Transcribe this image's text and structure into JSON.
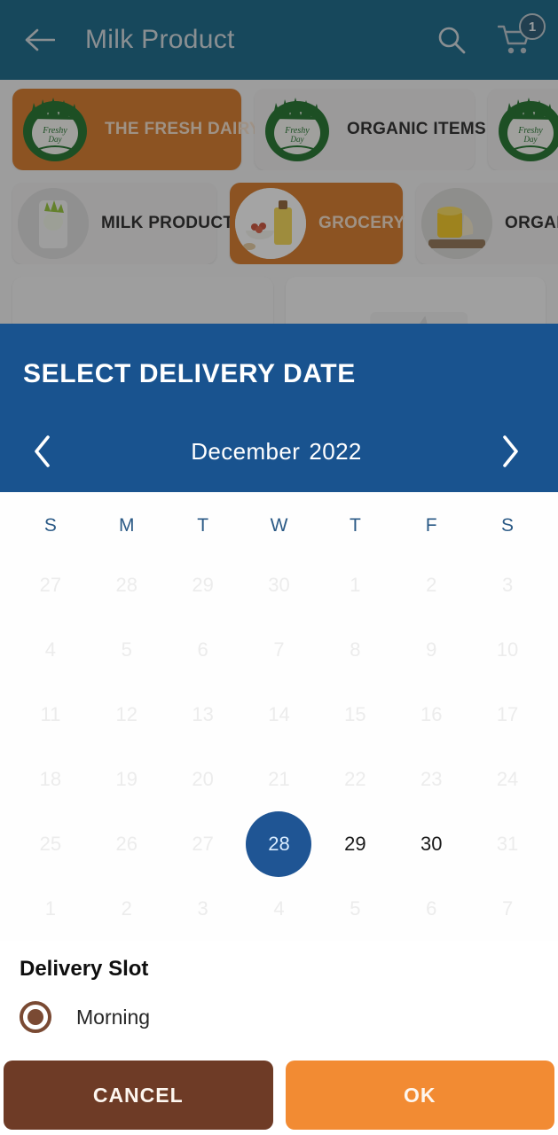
{
  "appbar": {
    "back_icon": "arrow-left-icon",
    "title": "Milk Product",
    "search_icon": "search-icon",
    "cart_icon": "shopping-cart-icon",
    "cart_badge": "1"
  },
  "categories": {
    "row1": [
      {
        "label": "THE FRESH DAIRY",
        "selected": true,
        "media": "logo"
      },
      {
        "label": "ORGANIC ITEMS",
        "selected": false,
        "media": "logo"
      },
      {
        "label": "",
        "selected": false,
        "media": "logo"
      }
    ],
    "row2": [
      {
        "label": "MILK PRODUCT",
        "selected": false,
        "media": "milk-pack-photo"
      },
      {
        "label": "GROCERY",
        "selected": true,
        "media": "grocery-photo"
      },
      {
        "label": "ORGANIC",
        "selected": false,
        "media": "butter-photo"
      }
    ]
  },
  "dialog": {
    "title": "SELECT DELIVERY DATE",
    "prev_icon": "chevron-left-icon",
    "next_icon": "chevron-right-icon",
    "month": "December",
    "year": "2022",
    "weekdays": [
      "S",
      "M",
      "T",
      "W",
      "T",
      "F",
      "S"
    ],
    "weeks": [
      [
        {
          "d": "27",
          "state": "muted"
        },
        {
          "d": "28",
          "state": "muted"
        },
        {
          "d": "29",
          "state": "muted"
        },
        {
          "d": "30",
          "state": "muted"
        },
        {
          "d": "1",
          "state": "muted"
        },
        {
          "d": "2",
          "state": "muted"
        },
        {
          "d": "3",
          "state": "muted"
        }
      ],
      [
        {
          "d": "4",
          "state": "muted"
        },
        {
          "d": "5",
          "state": "muted"
        },
        {
          "d": "6",
          "state": "muted"
        },
        {
          "d": "7",
          "state": "muted"
        },
        {
          "d": "8",
          "state": "muted"
        },
        {
          "d": "9",
          "state": "muted"
        },
        {
          "d": "10",
          "state": "muted"
        }
      ],
      [
        {
          "d": "11",
          "state": "muted"
        },
        {
          "d": "12",
          "state": "muted"
        },
        {
          "d": "13",
          "state": "muted"
        },
        {
          "d": "14",
          "state": "muted"
        },
        {
          "d": "15",
          "state": "muted"
        },
        {
          "d": "16",
          "state": "muted"
        },
        {
          "d": "17",
          "state": "muted"
        }
      ],
      [
        {
          "d": "18",
          "state": "muted"
        },
        {
          "d": "19",
          "state": "muted"
        },
        {
          "d": "20",
          "state": "muted"
        },
        {
          "d": "21",
          "state": "muted"
        },
        {
          "d": "22",
          "state": "muted"
        },
        {
          "d": "23",
          "state": "muted"
        },
        {
          "d": "24",
          "state": "muted"
        }
      ],
      [
        {
          "d": "25",
          "state": "muted"
        },
        {
          "d": "26",
          "state": "muted"
        },
        {
          "d": "27",
          "state": "muted"
        },
        {
          "d": "28",
          "state": "selected"
        },
        {
          "d": "29",
          "state": "enabled"
        },
        {
          "d": "30",
          "state": "enabled"
        },
        {
          "d": "31",
          "state": "muted"
        }
      ],
      [
        {
          "d": "1",
          "state": "muted"
        },
        {
          "d": "2",
          "state": "muted"
        },
        {
          "d": "3",
          "state": "muted"
        },
        {
          "d": "4",
          "state": "muted"
        },
        {
          "d": "5",
          "state": "muted"
        },
        {
          "d": "6",
          "state": "muted"
        },
        {
          "d": "7",
          "state": "muted"
        }
      ]
    ],
    "selected_day": "28",
    "slot_title": "Delivery Slot",
    "slots": [
      {
        "label": "Morning",
        "selected": true
      }
    ],
    "cancel_label": "CANCEL",
    "ok_label": "OK"
  },
  "colors": {
    "appbar": "#0a5d80",
    "dialog_header": "#19538f",
    "selected_day": "#1f5594",
    "chip_selected": "#d2711d",
    "cancel": "#6e3b26",
    "ok": "#f28b33",
    "radio": "#7a4a33",
    "weekday": "#2b5a86"
  }
}
